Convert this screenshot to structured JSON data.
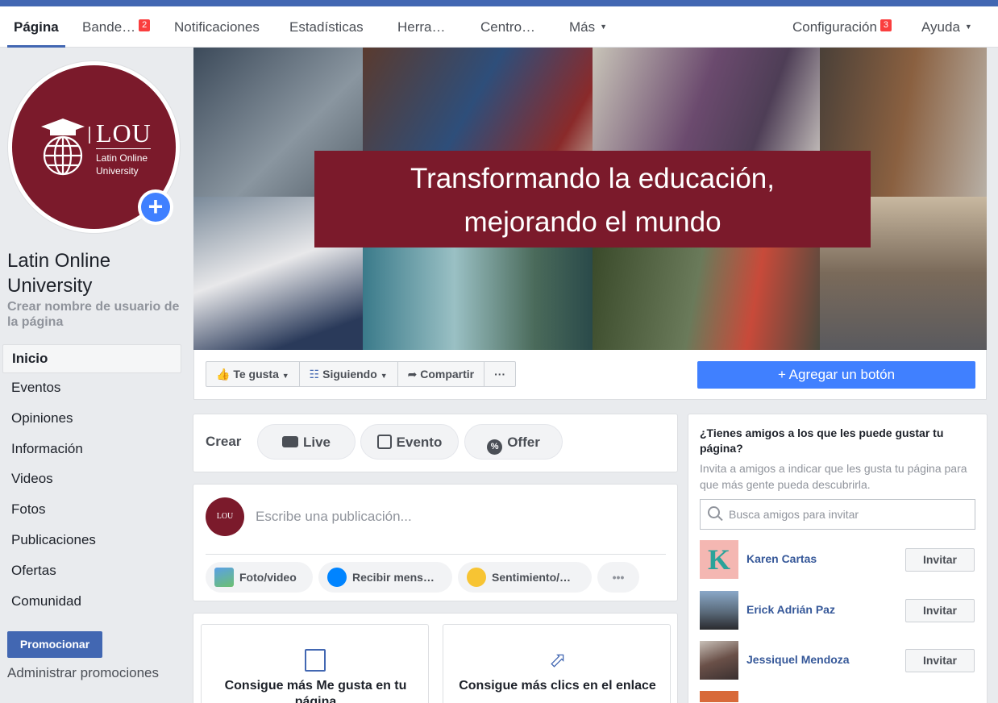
{
  "nav": {
    "tabs": [
      {
        "label": "Página"
      },
      {
        "label": "Bande…",
        "badge": "2"
      },
      {
        "label": "Notificaciones"
      },
      {
        "label": "Estadísticas"
      },
      {
        "label": "Herra…"
      },
      {
        "label": "Centro…"
      },
      {
        "label": "Más"
      }
    ],
    "settings": {
      "label": "Configuración",
      "badge": "3"
    },
    "help": {
      "label": "Ayuda"
    }
  },
  "profile": {
    "logo_title": "LOU",
    "logo_subtitle_1": "Latin Online",
    "logo_subtitle_2": "University",
    "page_name": "Latin Online University",
    "username_prompt": "Crear nombre de usuario de la página"
  },
  "sidenav": {
    "items": [
      {
        "label": "Inicio"
      },
      {
        "label": "Eventos"
      },
      {
        "label": "Opiniones"
      },
      {
        "label": "Información"
      },
      {
        "label": "Videos"
      },
      {
        "label": "Fotos"
      },
      {
        "label": "Publicaciones"
      },
      {
        "label": "Ofertas"
      },
      {
        "label": "Comunidad"
      }
    ],
    "promote": "Promocionar",
    "manage_promotions": "Administrar promociones"
  },
  "cover": {
    "line1": "Transformando la educación,",
    "line2": "mejorando el mundo"
  },
  "actions": {
    "like": "Te gusta",
    "following": "Siguiendo",
    "share": "Compartir",
    "more": "···",
    "add_button": "Agregar un botón"
  },
  "create": {
    "label": "Crear",
    "live": "Live",
    "event": "Evento",
    "offer": "Offer"
  },
  "composer": {
    "placeholder": "Escribe una publicación...",
    "photo": "Foto/video",
    "messages": "Recibir mens…",
    "feeling": "Sentimiento/…",
    "more": "•••"
  },
  "promo_cards": {
    "likes": "Consigue más Me gusta en tu página",
    "clicks": "Consigue más clics en el enlace"
  },
  "invite": {
    "title": "¿Tienes amigos a los que les puede gustar tu página?",
    "description": "Invita a amigos a indicar que les gusta tu página para que más gente pueda descubrirla.",
    "search_placeholder": "Busca amigos para invitar",
    "invite_label": "Invitar",
    "friends": [
      {
        "name": "Karen Cartas"
      },
      {
        "name": "Erick Adrián Paz"
      },
      {
        "name": "Jessiquel Mendoza"
      }
    ]
  },
  "colors": {
    "brand_blue": "#4267b2",
    "action_blue": "#4080ff",
    "lou_maroon": "#7b1a2b",
    "badge_red": "#fa3e3e"
  }
}
